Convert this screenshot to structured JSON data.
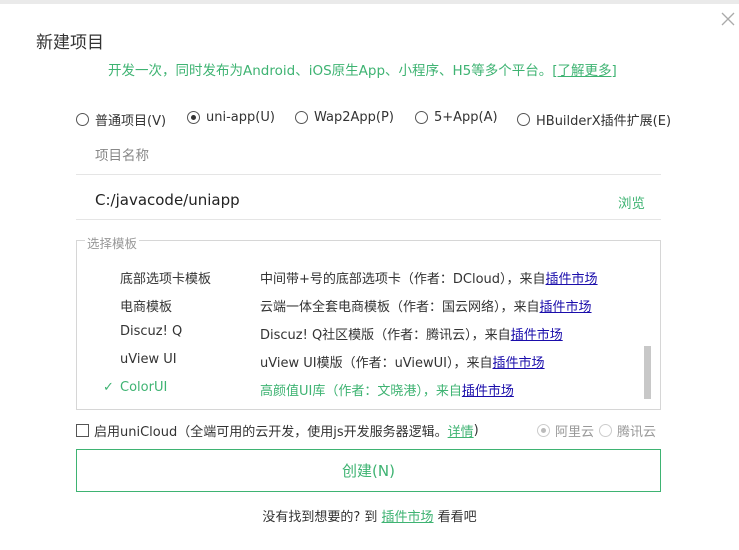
{
  "window": {
    "title": "新建项目",
    "subtitle": "开发一次，同时发布为Android、iOS原生App、小程序、H5等多个平台。",
    "learn_more": "[了解更多]",
    "close_icon": "close-icon"
  },
  "project_types": [
    {
      "label": "普通项目(V)",
      "checked": false
    },
    {
      "label": "uni-app(U)",
      "checked": true
    },
    {
      "label": "Wap2App(P)",
      "checked": false
    },
    {
      "label": "5+App(A)",
      "checked": false
    },
    {
      "label": "HBuilderX插件扩展(E)",
      "checked": false
    }
  ],
  "project_name": {
    "placeholder": "项目名称",
    "value": ""
  },
  "project_path": {
    "value": "C:/javacode/uniapp",
    "browse_label": "浏览"
  },
  "templates": {
    "legend": "选择模板",
    "items": [
      {
        "name": "底部选项卡模板",
        "desc": "中间带+号的底部选项卡（作者：DCloud），来自",
        "market": "插件市场",
        "selected": false
      },
      {
        "name": "电商模板",
        "desc": "云端一体全套电商模板（作者：国云网络），来自",
        "market": "插件市场",
        "selected": false
      },
      {
        "name": "Discuz! Q",
        "desc": "Discuz! Q社区模版（作者：腾讯云），来自",
        "market": "插件市场",
        "selected": false
      },
      {
        "name": "uView UI",
        "desc": "uView UI模版（作者：uViewUI），来自",
        "market": "插件市场",
        "selected": false
      },
      {
        "name": "ColorUI",
        "desc": "高颜值UI库（作者：文晓港），来自",
        "market": "插件市场",
        "selected": true,
        "check": "✓"
      }
    ]
  },
  "unicloud": {
    "label": "启用uniCloud（全端可用的云开发，使用js开发服务器逻辑。",
    "detail": "详情",
    "close_paren": ")",
    "checked": false,
    "providers": [
      {
        "label": "阿里云",
        "checked": true
      },
      {
        "label": "腾讯云",
        "checked": false
      }
    ]
  },
  "create_button": "创建(N)",
  "footer": {
    "before": "没有找到想要的? 到",
    "link": "插件市场",
    "after": "看看吧"
  },
  "colors": {
    "accent": "#3eb372",
    "link": "#1a0dab"
  }
}
